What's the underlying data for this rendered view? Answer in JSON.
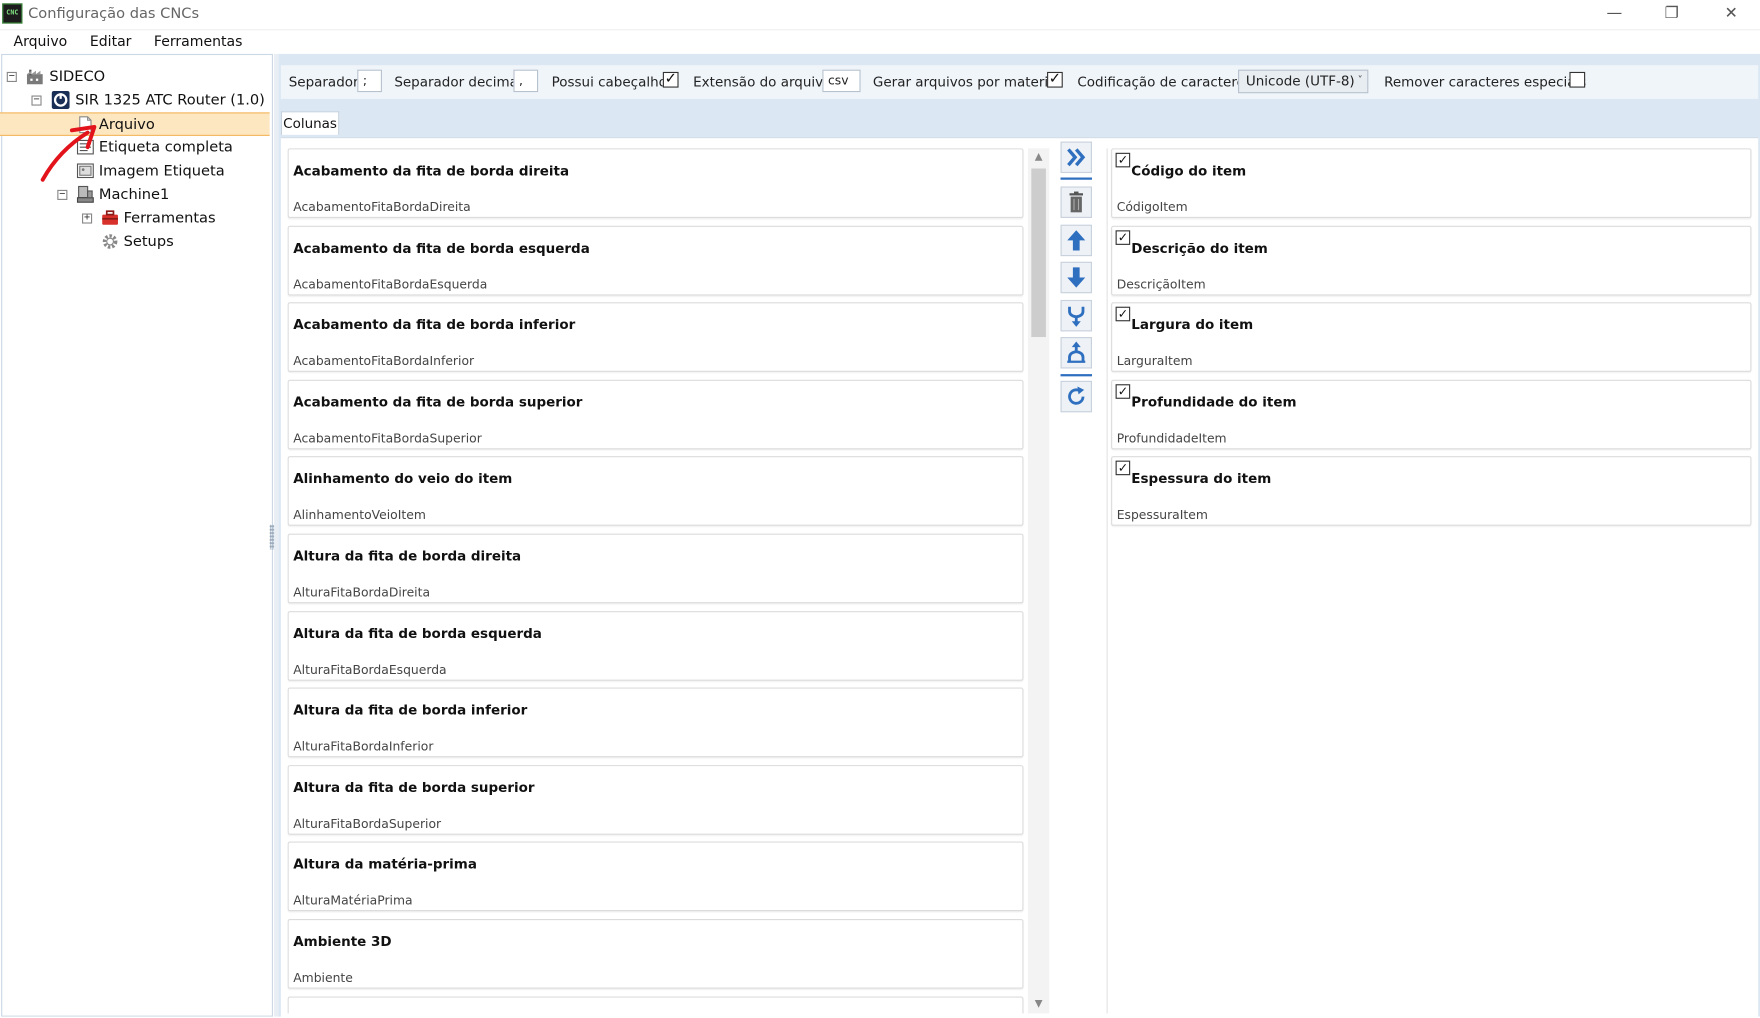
{
  "window": {
    "title": "Configuração das CNCs",
    "app_icon_text": "CNC",
    "minimize": "—",
    "restore": "❐",
    "close": "✕"
  },
  "menu": [
    "Arquivo",
    "Editar",
    "Ferramentas"
  ],
  "tree": {
    "root": "SIDECO",
    "machine_model": "SIR 1325 ATC Router (1.0)",
    "items": {
      "arquivo": "Arquivo",
      "etiqueta": "Etiqueta completa",
      "imagem": "Imagem Etiqueta"
    },
    "machine": "Machine1",
    "ferramentas": "Ferramentas",
    "setups": "Setups",
    "expander_minus": "−",
    "expander_plus": "+"
  },
  "toolbar": {
    "separador_label": "Separador",
    "separador_value": ";",
    "decimal_label": "Separador decimal",
    "decimal_value": ",",
    "cabecalho_label": "Possui cabeçalho",
    "cabecalho_checked": "✓",
    "extensao_label": "Extensão do arquivo",
    "extensao_value": "csv",
    "gerar_label": "Gerar arquivos por material",
    "gerar_checked": "✓",
    "codificacao_label": "Codificação de caracteres",
    "codificacao_value": "Unicode (UTF-8)",
    "caret": "˅",
    "remover_label": "Remover caracteres especiais",
    "remover_checked": ""
  },
  "tab": {
    "label": "Colunas"
  },
  "available_columns": [
    {
      "title": "Acabamento da fita de borda direita",
      "field": "AcabamentoFitaBordaDireita"
    },
    {
      "title": "Acabamento da fita de borda esquerda",
      "field": "AcabamentoFitaBordaEsquerda"
    },
    {
      "title": "Acabamento da fita de borda inferior",
      "field": "AcabamentoFitaBordaInferior"
    },
    {
      "title": "Acabamento da fita de borda superior",
      "field": "AcabamentoFitaBordaSuperior"
    },
    {
      "title": "Alinhamento do veio do item",
      "field": "AlinhamentoVeioItem"
    },
    {
      "title": "Altura da fita de borda direita",
      "field": "AlturaFitaBordaDireita"
    },
    {
      "title": "Altura da fita de borda esquerda",
      "field": "AlturaFitaBordaEsquerda"
    },
    {
      "title": "Altura da fita de borda inferior",
      "field": "AlturaFitaBordaInferior"
    },
    {
      "title": "Altura da fita de borda superior",
      "field": "AlturaFitaBordaSuperior"
    },
    {
      "title": "Altura da matéria-prima",
      "field": "AlturaMatériaPrima"
    },
    {
      "title": "Ambiente 3D",
      "field": "Ambiente"
    },
    {
      "title": "",
      "field": ""
    }
  ],
  "selected_columns": [
    {
      "title": "Código do item",
      "field": "CódigoItem",
      "checked": "✓"
    },
    {
      "title": "Descrição do item",
      "field": "DescriçãoItem",
      "checked": "✓"
    },
    {
      "title": "Largura do item",
      "field": "LarguraItem",
      "checked": "✓"
    },
    {
      "title": "Profundidade do item",
      "field": "ProfundidadeItem",
      "checked": "✓"
    },
    {
      "title": "Espessura do item",
      "field": "EspessuraItem",
      "checked": "✓"
    }
  ],
  "scroll": {
    "up": "▲",
    "down": "▼"
  },
  "colors": {
    "accent": "#2f6fbf",
    "selection": "#fde7c1",
    "selection_border": "#f3b760",
    "annotation_arrow": "#e3131b"
  }
}
